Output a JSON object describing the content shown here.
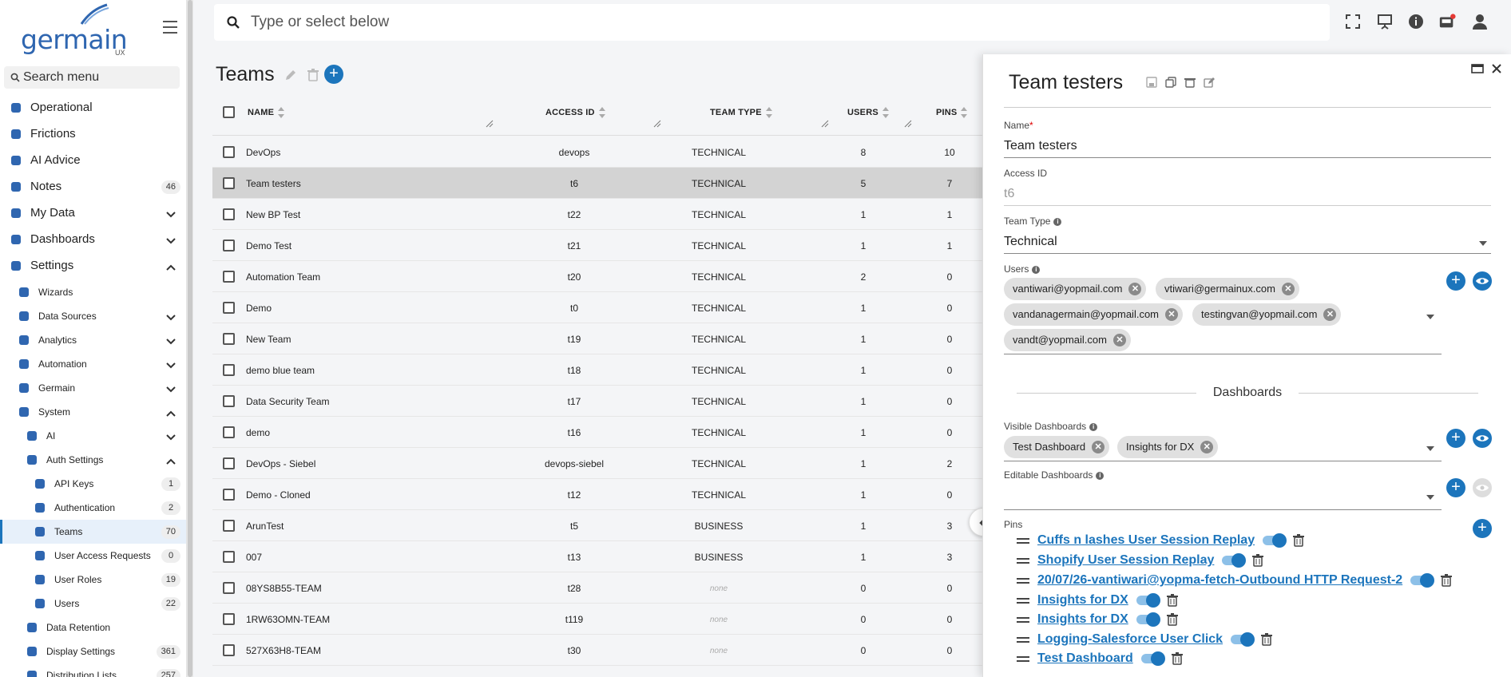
{
  "app": {
    "logo_text": "germain",
    "logo_sub": "UX"
  },
  "sidebar": {
    "search_placeholder": "Search menu",
    "items": [
      {
        "label": "Operational",
        "icon": "hierarchy-icon",
        "badge": "",
        "chevron": ""
      },
      {
        "label": "Frictions",
        "icon": "friction-icon",
        "badge": "",
        "chevron": ""
      },
      {
        "label": "AI Advice",
        "icon": "brain-icon",
        "badge": "",
        "chevron": ""
      },
      {
        "label": "Notes",
        "icon": "chat-bubble-icon",
        "badge": "46",
        "chevron": ""
      },
      {
        "label": "My Data",
        "icon": "bookmark-icon",
        "badge": "",
        "chevron": "down"
      },
      {
        "label": "Dashboards",
        "icon": "chart-icon",
        "badge": "",
        "chevron": "down"
      },
      {
        "label": "Settings",
        "icon": "tools-icon",
        "badge": "",
        "chevron": "up"
      },
      {
        "label": "Wizards",
        "icon": "wand-icon",
        "badge": "",
        "chevron": ""
      },
      {
        "label": "Data Sources",
        "icon": "database-icon",
        "badge": "",
        "chevron": "down"
      },
      {
        "label": "Analytics",
        "icon": "line-chart-icon",
        "badge": "",
        "chevron": "down"
      },
      {
        "label": "Automation",
        "icon": "robot-icon",
        "badge": "",
        "chevron": "down"
      },
      {
        "label": "Germain",
        "icon": "gears-icon",
        "badge": "",
        "chevron": "down"
      },
      {
        "label": "System",
        "icon": "server-icon",
        "badge": "",
        "chevron": "up"
      },
      {
        "label": "AI",
        "icon": "brain-icon",
        "badge": "",
        "chevron": "down"
      },
      {
        "label": "Auth Settings",
        "icon": "id-card-icon",
        "badge": "",
        "chevron": "up"
      },
      {
        "label": "API Keys",
        "icon": "key-icon",
        "badge": "1",
        "chevron": ""
      },
      {
        "label": "Authentication",
        "icon": "id-badge-icon",
        "badge": "2",
        "chevron": ""
      },
      {
        "label": "Teams",
        "icon": "users-group-icon",
        "badge": "70",
        "chevron": ""
      },
      {
        "label": "User Access Requests",
        "icon": "user-plus-icon",
        "badge": "0",
        "chevron": ""
      },
      {
        "label": "User Roles",
        "icon": "users-cog-icon",
        "badge": "19",
        "chevron": ""
      },
      {
        "label": "Users",
        "icon": "user-icon",
        "badge": "22",
        "chevron": ""
      },
      {
        "label": "Data Retention",
        "icon": "archive-icon",
        "badge": "",
        "chevron": ""
      },
      {
        "label": "Display Settings",
        "icon": "display-icon",
        "badge": "361",
        "chevron": ""
      },
      {
        "label": "Distribution Lists",
        "icon": "list-icon",
        "badge": "257",
        "chevron": ""
      }
    ]
  },
  "topbar": {
    "search_placeholder": "Type or select below"
  },
  "teams": {
    "title": "Teams",
    "columns": [
      "NAME",
      "ACCESS ID",
      "TEAM TYPE",
      "USERS",
      "PINS"
    ],
    "rows": [
      {
        "name": "DevOps",
        "access_id": "devops",
        "team_type": "TECHNICAL",
        "users": "8",
        "pins": "10"
      },
      {
        "name": "Team testers",
        "access_id": "t6",
        "team_type": "TECHNICAL",
        "users": "5",
        "pins": "7"
      },
      {
        "name": "New BP Test",
        "access_id": "t22",
        "team_type": "TECHNICAL",
        "users": "1",
        "pins": "1"
      },
      {
        "name": "Demo Test",
        "access_id": "t21",
        "team_type": "TECHNICAL",
        "users": "1",
        "pins": "1"
      },
      {
        "name": "Automation Team",
        "access_id": "t20",
        "team_type": "TECHNICAL",
        "users": "2",
        "pins": "0"
      },
      {
        "name": "Demo",
        "access_id": "t0",
        "team_type": "TECHNICAL",
        "users": "1",
        "pins": "0"
      },
      {
        "name": "New Team",
        "access_id": "t19",
        "team_type": "TECHNICAL",
        "users": "1",
        "pins": "0"
      },
      {
        "name": "demo blue team",
        "access_id": "t18",
        "team_type": "TECHNICAL",
        "users": "1",
        "pins": "0"
      },
      {
        "name": "Data Security Team",
        "access_id": "t17",
        "team_type": "TECHNICAL",
        "users": "1",
        "pins": "0"
      },
      {
        "name": "demo",
        "access_id": "t16",
        "team_type": "TECHNICAL",
        "users": "1",
        "pins": "0"
      },
      {
        "name": "DevOps - Siebel",
        "access_id": "devops-siebel",
        "team_type": "TECHNICAL",
        "users": "1",
        "pins": "2"
      },
      {
        "name": "Demo - Cloned",
        "access_id": "t12",
        "team_type": "TECHNICAL",
        "users": "1",
        "pins": "0"
      },
      {
        "name": "ArunTest",
        "access_id": "t5",
        "team_type": "BUSINESS",
        "users": "1",
        "pins": "3"
      },
      {
        "name": "007",
        "access_id": "t13",
        "team_type": "BUSINESS",
        "users": "1",
        "pins": "3"
      },
      {
        "name": "08YS8B55-TEAM",
        "access_id": "t28",
        "team_type": "none",
        "users": "0",
        "pins": "0"
      },
      {
        "name": "1RW63OMN-TEAM",
        "access_id": "t119",
        "team_type": "none",
        "users": "0",
        "pins": "0"
      },
      {
        "name": "527X63H8-TEAM",
        "access_id": "t30",
        "team_type": "none",
        "users": "0",
        "pins": "0"
      }
    ]
  },
  "panel": {
    "title": "Team testers",
    "name_label": "Name",
    "name_required": "*",
    "name_value": "Team testers",
    "access_label": "Access ID",
    "access_value": "t6",
    "type_label": "Team Type",
    "type_value": "Technical",
    "users_label": "Users",
    "users": [
      "vantiwari@yopmail.com",
      "vtiwari@germainux.com",
      "vandanagermain@yopmail.com",
      "testingvan@yopmail.com",
      "vandt@yopmail.com"
    ],
    "dashboards_title": "Dashboards",
    "visible_label": "Visible Dashboards",
    "visible": [
      "Test Dashboard",
      "Insights for DX"
    ],
    "editable_label": "Editable Dashboards",
    "pins_label": "Pins",
    "pins": [
      "Cuffs n lashes User Session Replay",
      "Shopify User Session Replay",
      "20/07/26-vantiwari@yopma-fetch-Outbound HTTP Request-2",
      "Insights for DX",
      "Insights for DX",
      "Logging-Salesforce User Click",
      "Test Dashboard"
    ]
  },
  "colors": {
    "accent": "#1c75bc",
    "selected_row": "#d3d3d3",
    "notification": "#e53935"
  }
}
